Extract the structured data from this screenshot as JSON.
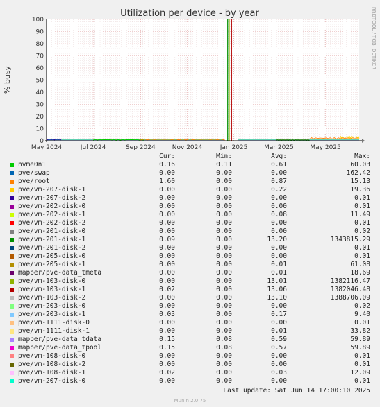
{
  "chart_data": {
    "type": "line",
    "title": "Utilization per device - by year",
    "ylabel": "% busy",
    "xlabel": "",
    "ylim": [
      0,
      100
    ],
    "yticks": [
      0,
      10,
      20,
      30,
      40,
      50,
      60,
      70,
      80,
      90,
      100
    ],
    "xlim": [
      "2024-05-01",
      "2025-06-14"
    ],
    "xticks": [
      "May 2024",
      "Jul 2024",
      "Sep 2024",
      "Nov 2024",
      "Jan 2025",
      "Mar 2025",
      "May 2025"
    ],
    "xtick_dates": [
      "2024-05-01",
      "2024-07-01",
      "2024-09-01",
      "2024-11-01",
      "2025-01-01",
      "2025-03-01",
      "2025-05-01"
    ],
    "grid": true,
    "side_label": "RRDTOOL / TOBI OETIKER",
    "spikes": [
      {
        "series": "pve/vm-201-disk-1",
        "x": "2024-12-24",
        "y": 100
      },
      {
        "series": "pve/vm-103-disk-0",
        "x": "2024-12-26",
        "y": 100
      },
      {
        "series": "pve/vm-103-disk-1",
        "x": "2024-12-29",
        "y": 100
      }
    ],
    "series": [
      {
        "name": "nvme0n1",
        "color": "#00cc00",
        "cur": "0.16",
        "min": "0.11",
        "avg": "0.61",
        "max": "60.03"
      },
      {
        "name": "pve/swap",
        "color": "#0066b3",
        "cur": "0.00",
        "min": "0.00",
        "avg": "0.00",
        "max": "162.42"
      },
      {
        "name": "pve/root",
        "color": "#ff8000",
        "cur": "1.60",
        "min": "0.00",
        "avg": "0.87",
        "max": "15.13"
      },
      {
        "name": "pve/vm-207-disk-1",
        "color": "#ffcc00",
        "cur": "0.00",
        "min": "0.00",
        "avg": "0.22",
        "max": "19.36"
      },
      {
        "name": "pve/vm-207-disk-2",
        "color": "#330099",
        "cur": "0.00",
        "min": "0.00",
        "avg": "0.00",
        "max": "0.01"
      },
      {
        "name": "pve/vm-202-disk-0",
        "color": "#990099",
        "cur": "0.00",
        "min": "0.00",
        "avg": "0.00",
        "max": "0.01"
      },
      {
        "name": "pve/vm-202-disk-1",
        "color": "#ccff00",
        "cur": "0.00",
        "min": "0.00",
        "avg": "0.08",
        "max": "11.49"
      },
      {
        "name": "pve/vm-202-disk-2",
        "color": "#ff0000",
        "cur": "0.00",
        "min": "0.00",
        "avg": "0.00",
        "max": "0.01"
      },
      {
        "name": "pve/vm-201-disk-0",
        "color": "#808080",
        "cur": "0.00",
        "min": "0.00",
        "avg": "0.00",
        "max": "0.02"
      },
      {
        "name": "pve/vm-201-disk-1",
        "color": "#008f00",
        "cur": "0.09",
        "min": "0.00",
        "avg": "13.20",
        "max": "1343815.29"
      },
      {
        "name": "pve/vm-201-disk-2",
        "color": "#00487d",
        "cur": "0.00",
        "min": "0.00",
        "avg": "0.00",
        "max": "0.01"
      },
      {
        "name": "pve/vm-205-disk-0",
        "color": "#b35a00",
        "cur": "0.00",
        "min": "0.00",
        "avg": "0.00",
        "max": "0.01"
      },
      {
        "name": "pve/vm-205-disk-1",
        "color": "#b38f00",
        "cur": "0.00",
        "min": "0.00",
        "avg": "0.01",
        "max": "61.08"
      },
      {
        "name": "mapper/pve-data_tmeta",
        "color": "#6b006b",
        "cur": "0.00",
        "min": "0.00",
        "avg": "0.01",
        "max": "18.69"
      },
      {
        "name": "pve/vm-103-disk-0",
        "color": "#8fb300",
        "cur": "0.00",
        "min": "0.00",
        "avg": "13.01",
        "max": "1382116.47"
      },
      {
        "name": "pve/vm-103-disk-1",
        "color": "#b30000",
        "cur": "0.02",
        "min": "0.00",
        "avg": "13.06",
        "max": "1382046.48"
      },
      {
        "name": "pve/vm-103-disk-2",
        "color": "#bebebe",
        "cur": "0.00",
        "min": "0.00",
        "avg": "13.10",
        "max": "1388706.09"
      },
      {
        "name": "pve/vm-203-disk-0",
        "color": "#80ff80",
        "cur": "0.00",
        "min": "0.00",
        "avg": "0.00",
        "max": "0.02"
      },
      {
        "name": "pve/vm-203-disk-1",
        "color": "#80c9ff",
        "cur": "0.03",
        "min": "0.00",
        "avg": "0.17",
        "max": "9.40"
      },
      {
        "name": "pve/vm-1111-disk-0",
        "color": "#ffc080",
        "cur": "0.00",
        "min": "0.00",
        "avg": "0.00",
        "max": "0.01"
      },
      {
        "name": "pve/vm-1111-disk-1",
        "color": "#ffe680",
        "cur": "0.00",
        "min": "0.00",
        "avg": "0.01",
        "max": "33.82"
      },
      {
        "name": "mapper/pve-data_tdata",
        "color": "#aa80ff",
        "cur": "0.15",
        "min": "0.08",
        "avg": "0.59",
        "max": "59.89"
      },
      {
        "name": "mapper/pve-data_tpool",
        "color": "#ee00cc",
        "cur": "0.15",
        "min": "0.08",
        "avg": "0.57",
        "max": "59.89"
      },
      {
        "name": "pve/vm-108-disk-0",
        "color": "#ff8080",
        "cur": "0.00",
        "min": "0.00",
        "avg": "0.00",
        "max": "0.01"
      },
      {
        "name": "pve/vm-108-disk-2",
        "color": "#666600",
        "cur": "0.00",
        "min": "0.00",
        "avg": "0.00",
        "max": "0.01"
      },
      {
        "name": "pve/vm-108-disk-1",
        "color": "#ffbfff",
        "cur": "0.02",
        "min": "0.00",
        "avg": "0.03",
        "max": "12.09"
      },
      {
        "name": "pve/vm-207-disk-0",
        "color": "#00ffcc",
        "cur": "0.00",
        "min": "0.00",
        "avg": "0.00",
        "max": "0.01"
      }
    ]
  },
  "legend_headers": {
    "cur": "Cur:",
    "min": "Min:",
    "avg": "Avg:",
    "max": "Max:"
  },
  "footer": {
    "last_update": "Last update: Sat Jun 14 17:00:10 2025",
    "version": "Munin 2.0.75"
  }
}
